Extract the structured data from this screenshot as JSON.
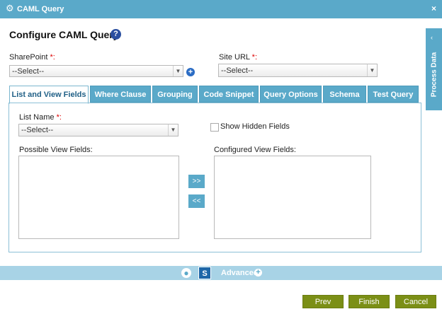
{
  "window": {
    "title": "CAML Query",
    "close_glyph": "×",
    "icon": "gear-icon"
  },
  "heading": {
    "title": "Configure CAML Query",
    "help_glyph": "?"
  },
  "sharepoint": {
    "label": "SharePoint",
    "required": "*:",
    "value": "--Select--",
    "add_glyph": "+"
  },
  "site_url": {
    "label": "Site URL",
    "required": "*:",
    "value": "--Select--"
  },
  "side_panel": {
    "label": "Process Data",
    "chevron": "‹"
  },
  "tabs": [
    {
      "label": "List and View Fields",
      "active": true
    },
    {
      "label": "Where Clause"
    },
    {
      "label": "Grouping"
    },
    {
      "label": "Code Snippet"
    },
    {
      "label": "Query Options"
    },
    {
      "label": "Schema"
    },
    {
      "label": "Test Query"
    }
  ],
  "list_name": {
    "label": "List Name",
    "required": "*:",
    "value": "--Select--"
  },
  "show_hidden": {
    "label": "Show Hidden Fields",
    "checked": false
  },
  "possible_fields": {
    "label": "Possible View Fields:"
  },
  "configured_fields": {
    "label": "Configured View Fields:"
  },
  "move": {
    "add": ">>",
    "remove": "<<"
  },
  "bottom": {
    "advanced_label": "Advanced",
    "advanced_plus": "+",
    "sp_glyph": "S"
  },
  "actions": {
    "prev": "Prev",
    "finish": "Finish",
    "cancel": "Cancel"
  },
  "colors": {
    "accent": "#5aa9c9",
    "action": "#7b8f16",
    "required": "#dd0000"
  }
}
